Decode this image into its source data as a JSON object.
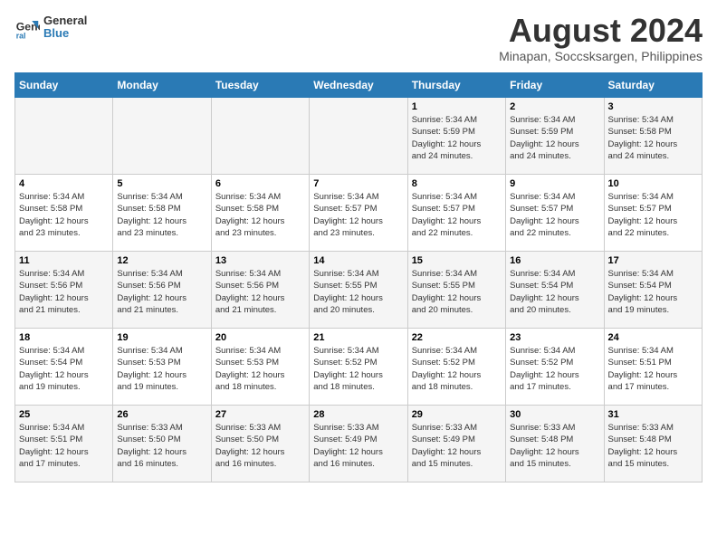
{
  "header": {
    "logo_line1": "General",
    "logo_line2": "Blue",
    "month_title": "August 2024",
    "location": "Minapan, Soccsksargen, Philippines"
  },
  "days_of_week": [
    "Sunday",
    "Monday",
    "Tuesday",
    "Wednesday",
    "Thursday",
    "Friday",
    "Saturday"
  ],
  "weeks": [
    [
      {
        "day": "",
        "info": ""
      },
      {
        "day": "",
        "info": ""
      },
      {
        "day": "",
        "info": ""
      },
      {
        "day": "",
        "info": ""
      },
      {
        "day": "1",
        "info": "Sunrise: 5:34 AM\nSunset: 5:59 PM\nDaylight: 12 hours\nand 24 minutes."
      },
      {
        "day": "2",
        "info": "Sunrise: 5:34 AM\nSunset: 5:59 PM\nDaylight: 12 hours\nand 24 minutes."
      },
      {
        "day": "3",
        "info": "Sunrise: 5:34 AM\nSunset: 5:58 PM\nDaylight: 12 hours\nand 24 minutes."
      }
    ],
    [
      {
        "day": "4",
        "info": "Sunrise: 5:34 AM\nSunset: 5:58 PM\nDaylight: 12 hours\nand 23 minutes."
      },
      {
        "day": "5",
        "info": "Sunrise: 5:34 AM\nSunset: 5:58 PM\nDaylight: 12 hours\nand 23 minutes."
      },
      {
        "day": "6",
        "info": "Sunrise: 5:34 AM\nSunset: 5:58 PM\nDaylight: 12 hours\nand 23 minutes."
      },
      {
        "day": "7",
        "info": "Sunrise: 5:34 AM\nSunset: 5:57 PM\nDaylight: 12 hours\nand 23 minutes."
      },
      {
        "day": "8",
        "info": "Sunrise: 5:34 AM\nSunset: 5:57 PM\nDaylight: 12 hours\nand 22 minutes."
      },
      {
        "day": "9",
        "info": "Sunrise: 5:34 AM\nSunset: 5:57 PM\nDaylight: 12 hours\nand 22 minutes."
      },
      {
        "day": "10",
        "info": "Sunrise: 5:34 AM\nSunset: 5:57 PM\nDaylight: 12 hours\nand 22 minutes."
      }
    ],
    [
      {
        "day": "11",
        "info": "Sunrise: 5:34 AM\nSunset: 5:56 PM\nDaylight: 12 hours\nand 21 minutes."
      },
      {
        "day": "12",
        "info": "Sunrise: 5:34 AM\nSunset: 5:56 PM\nDaylight: 12 hours\nand 21 minutes."
      },
      {
        "day": "13",
        "info": "Sunrise: 5:34 AM\nSunset: 5:56 PM\nDaylight: 12 hours\nand 21 minutes."
      },
      {
        "day": "14",
        "info": "Sunrise: 5:34 AM\nSunset: 5:55 PM\nDaylight: 12 hours\nand 20 minutes."
      },
      {
        "day": "15",
        "info": "Sunrise: 5:34 AM\nSunset: 5:55 PM\nDaylight: 12 hours\nand 20 minutes."
      },
      {
        "day": "16",
        "info": "Sunrise: 5:34 AM\nSunset: 5:54 PM\nDaylight: 12 hours\nand 20 minutes."
      },
      {
        "day": "17",
        "info": "Sunrise: 5:34 AM\nSunset: 5:54 PM\nDaylight: 12 hours\nand 19 minutes."
      }
    ],
    [
      {
        "day": "18",
        "info": "Sunrise: 5:34 AM\nSunset: 5:54 PM\nDaylight: 12 hours\nand 19 minutes."
      },
      {
        "day": "19",
        "info": "Sunrise: 5:34 AM\nSunset: 5:53 PM\nDaylight: 12 hours\nand 19 minutes."
      },
      {
        "day": "20",
        "info": "Sunrise: 5:34 AM\nSunset: 5:53 PM\nDaylight: 12 hours\nand 18 minutes."
      },
      {
        "day": "21",
        "info": "Sunrise: 5:34 AM\nSunset: 5:52 PM\nDaylight: 12 hours\nand 18 minutes."
      },
      {
        "day": "22",
        "info": "Sunrise: 5:34 AM\nSunset: 5:52 PM\nDaylight: 12 hours\nand 18 minutes."
      },
      {
        "day": "23",
        "info": "Sunrise: 5:34 AM\nSunset: 5:52 PM\nDaylight: 12 hours\nand 17 minutes."
      },
      {
        "day": "24",
        "info": "Sunrise: 5:34 AM\nSunset: 5:51 PM\nDaylight: 12 hours\nand 17 minutes."
      }
    ],
    [
      {
        "day": "25",
        "info": "Sunrise: 5:34 AM\nSunset: 5:51 PM\nDaylight: 12 hours\nand 17 minutes."
      },
      {
        "day": "26",
        "info": "Sunrise: 5:33 AM\nSunset: 5:50 PM\nDaylight: 12 hours\nand 16 minutes."
      },
      {
        "day": "27",
        "info": "Sunrise: 5:33 AM\nSunset: 5:50 PM\nDaylight: 12 hours\nand 16 minutes."
      },
      {
        "day": "28",
        "info": "Sunrise: 5:33 AM\nSunset: 5:49 PM\nDaylight: 12 hours\nand 16 minutes."
      },
      {
        "day": "29",
        "info": "Sunrise: 5:33 AM\nSunset: 5:49 PM\nDaylight: 12 hours\nand 15 minutes."
      },
      {
        "day": "30",
        "info": "Sunrise: 5:33 AM\nSunset: 5:48 PM\nDaylight: 12 hours\nand 15 minutes."
      },
      {
        "day": "31",
        "info": "Sunrise: 5:33 AM\nSunset: 5:48 PM\nDaylight: 12 hours\nand 15 minutes."
      }
    ]
  ]
}
